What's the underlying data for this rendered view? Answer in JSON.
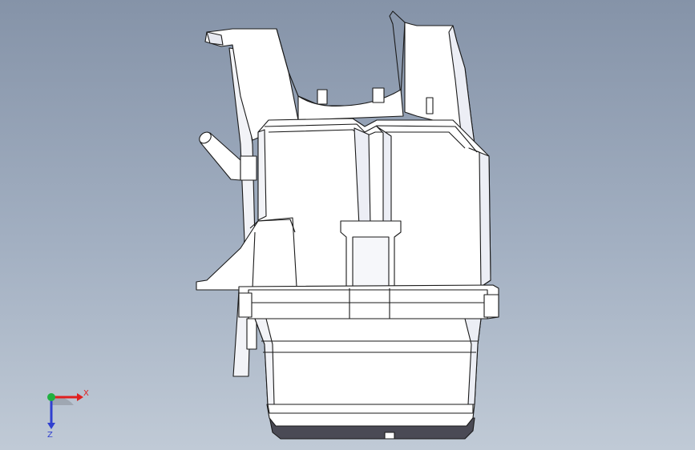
{
  "viewport": {
    "background_top": "#8593a8",
    "background_bottom": "#c0cad6"
  },
  "model": {
    "body_fill": "#ffffff",
    "edge_color": "#1a1a1a",
    "shade_fill": "#dde0ea",
    "dark_fill": "#4a4a55"
  },
  "triad": {
    "x_label": "X",
    "z_label": "Z",
    "x_color": "#e02020",
    "y_color": "#20b040",
    "z_color": "#3040d0"
  }
}
